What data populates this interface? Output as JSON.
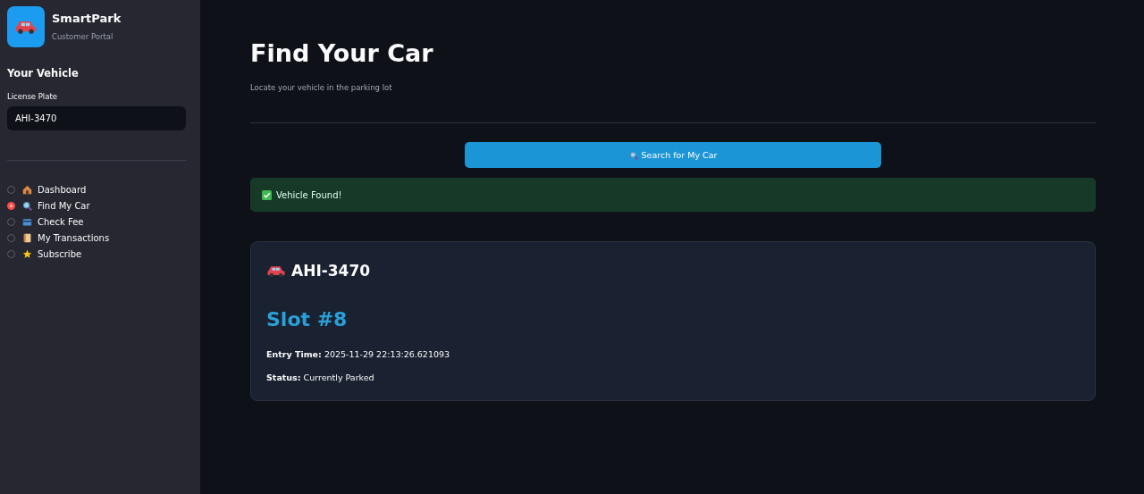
{
  "sidebar": {
    "app_name": "SmartPark",
    "app_subtitle": "Customer Portal",
    "section_title": "Your Vehicle",
    "plate_field": {
      "label": "License Plate",
      "value": "AHI-3470"
    },
    "nav": [
      {
        "label": "Dashboard",
        "selected": false
      },
      {
        "label": "Find My Car",
        "selected": true
      },
      {
        "label": "Check Fee",
        "selected": false
      },
      {
        "label": "My Transactions",
        "selected": false
      },
      {
        "label": "Subscribe",
        "selected": false
      }
    ]
  },
  "main": {
    "title": "Find Your Car",
    "subtitle": "Locate your vehicle in the parking lot",
    "search_button": "Search for My Car",
    "alert": {
      "kind": "success",
      "text": "Vehicle Found!"
    },
    "card": {
      "plate": "AHI-3470",
      "slot": "Slot #8",
      "fields": [
        {
          "label": "Entry Time:",
          "value": "2025-11-29 22:13:26.621093"
        },
        {
          "label": "Status:",
          "value": "Currently Parked"
        }
      ]
    }
  }
}
